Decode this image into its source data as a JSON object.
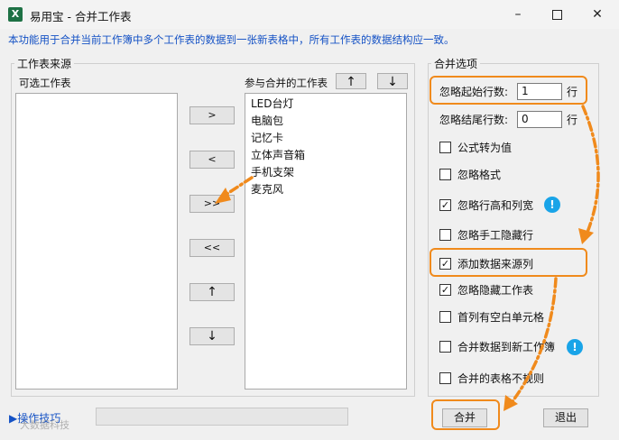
{
  "window": {
    "app_icon": "X",
    "title": "易用宝 - 合并工作表",
    "minimize_icon": "minimize-icon",
    "maximize_icon": "maximize-icon",
    "close_icon": "close-icon"
  },
  "description": "本功能用于合并当前工作簿中多个工作表的数据到一张新表格中，所有工作表的数据结构应一致。",
  "source_group": {
    "legend": "工作表来源",
    "available_label": "可选工作表",
    "available_items": [],
    "selected_label": "参与合并的工作表",
    "selected_items": [
      "LED台灯",
      "电脑包",
      "记忆卡",
      "立体声音箱",
      "手机支架",
      "麦克风"
    ],
    "move_up": "↑",
    "move_down": "↓",
    "transfer_buttons": [
      ">",
      "<",
      ">>",
      "<<",
      "↑",
      "↓"
    ]
  },
  "options_group": {
    "legend": "合并选项",
    "skip_start_rows_label": "忽略起始行数:",
    "skip_start_rows_value": "1",
    "skip_start_rows_unit": "行",
    "skip_end_rows_label": "忽略结尾行数:",
    "skip_end_rows_value": "0",
    "skip_end_rows_unit": "行",
    "checkboxes": [
      {
        "label": "公式转为值",
        "checked": false
      },
      {
        "label": "忽略格式",
        "checked": false
      },
      {
        "label": "忽略行高和列宽",
        "checked": true
      },
      {
        "label": "忽略手工隐藏行",
        "checked": false
      },
      {
        "label": "添加数据来源列",
        "checked": true
      },
      {
        "label": "忽略隐藏工作表",
        "checked": true
      },
      {
        "label": "首列有空白单元格",
        "checked": false
      },
      {
        "label": "合并数据到新工作簿",
        "checked": false
      },
      {
        "label": "合并的表格不规则",
        "checked": false
      }
    ],
    "info_icon": "!"
  },
  "footer": {
    "tips_label": "▶操作技巧",
    "merge_button": "合并",
    "exit_button": "退出",
    "watermark": "大数据科技"
  },
  "highlight_color": "#f08a1c"
}
